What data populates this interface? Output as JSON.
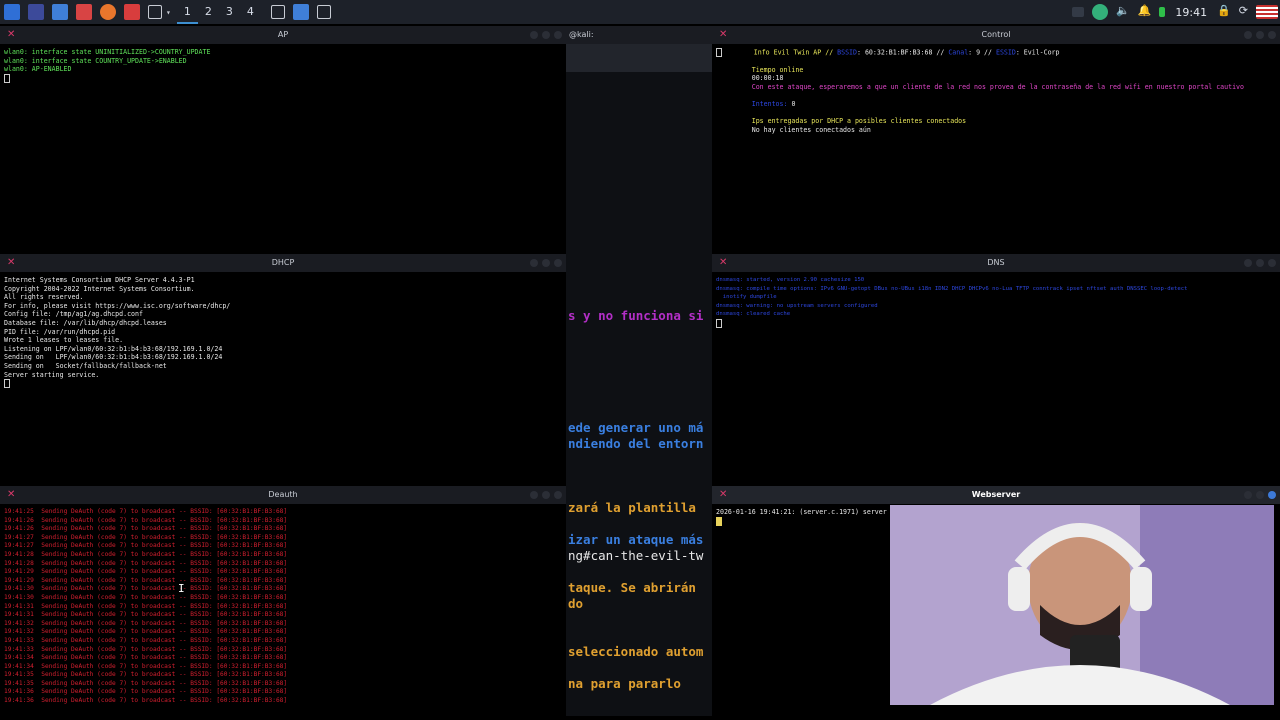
{
  "taskbar": {
    "workspaces": [
      "1",
      "2",
      "3",
      "4"
    ],
    "clock": "19:41",
    "icons": [
      "kali-menu-icon",
      "desktop-icon",
      "files-icon",
      "editor-icon",
      "firefox-icon",
      "burp-icon",
      "terminal-icon",
      "terminal-badge-icon",
      "files-blue-icon",
      "terminal-six-icon"
    ],
    "tray_icons": [
      "screen-icon",
      "refresh-icon",
      "volume-icon",
      "bell-icon",
      "battery-icon",
      "lock-icon",
      "reload-icon",
      "flag-us-icon"
    ]
  },
  "windows": {
    "ap": {
      "title": "AP",
      "lines": [
        "wlan0: interface state UNINITIALIZED->COUNTRY_UPDATE",
        "wlan0: interface state COUNTRY_UPDATE->ENABLED",
        "wlan0: AP-ENABLED"
      ]
    },
    "main": {
      "title": "@kali: ~/Desktop/arsenal/airgeddon",
      "fragments": [
        {
          "text": "s y no funciona si",
          "color": "#b32fc7"
        },
        {
          "text": "ede generar uno má",
          "color": "#3a7fe0"
        },
        {
          "text": "ndiendo del entorn",
          "color": "#3a7fe0"
        },
        {
          "text": "zará la plantilla",
          "color": "#e0a030"
        },
        {
          "text": "izar un ataque más",
          "color": "#3a7fe0"
        },
        {
          "text": "ng#can-the-evil-tw",
          "color": "#e8e8e8"
        },
        {
          "text": "taque. Se abrirán",
          "color": "#e0a030"
        },
        {
          "text": "do",
          "color": "#e0a030"
        },
        {
          "text": "seleccionado autom",
          "color": "#e0a030"
        },
        {
          "text": "na para pararlo",
          "color": "#e0a030"
        }
      ]
    },
    "control": {
      "title": "Control",
      "header_prefix": "Info Evil Twin AP // ",
      "bssid_label": "BSSID",
      "bssid_value": ": 60:32:B1:BF:B3:68 // ",
      "channel_label": "Canal",
      "channel_value": ": 9 // ",
      "essid_label": "ESSID",
      "essid_value": ": Evil-Corp",
      "time_label": "Tiempo online",
      "time_value": "00:00:18",
      "attack_desc": "Con este ataque, esperaremos a que un cliente de la red nos provea de la contraseña de la red wifi en nuestro portal cautivo",
      "attempts_label": "Intentos:",
      "attempts_value": " 0",
      "dhcp_header": "Ips entregadas por DHCP a posibles clientes conectados",
      "no_clients": "No hay clientes conectados aún"
    },
    "dhcp": {
      "title": "DHCP",
      "lines": [
        "Internet Systems Consortium DHCP Server 4.4.3-P1",
        "Copyright 2004-2022 Internet Systems Consortium.",
        "All rights reserved.",
        "For info, please visit https://www.isc.org/software/dhcp/",
        "Config file: /tmp/ag1/ag.dhcpd.conf",
        "Database file: /var/lib/dhcp/dhcpd.leases",
        "PID file: /var/run/dhcpd.pid",
        "Wrote 1 leases to leases file.",
        "Listening on LPF/wlan0/60:32:b1:b4:b3:68/192.169.1.0/24",
        "Sending on   LPF/wlan0/60:32:b1:b4:b3:68/192.169.1.0/24",
        "Sending on   Socket/fallback/fallback-net",
        "Server starting service."
      ]
    },
    "dns": {
      "title": "DNS",
      "lines": [
        "dnsmasq: started, version 2.90 cachesize 150",
        "dnsmasq: compile time options: IPv6 GNU-getopt DBus no-UBus i18n IDN2 DHCP DHCPv6 no-Lua TFTP conntrack ipset nftset auth DNSSEC loop-detect",
        "  inotify dumpfile",
        "dnsmasq: warning: no upstream servers configured",
        "dnsmasq: cleared cache"
      ]
    },
    "deauth": {
      "title": "Deauth",
      "lines": [
        "19:41:25  Sending DeAuth (code 7) to broadcast -- BSSID: [60:32:B1:BF:B3:68]",
        "19:41:26  Sending DeAuth (code 7) to broadcast -- BSSID: [60:32:B1:BF:B3:68]",
        "19:41:26  Sending DeAuth (code 7) to broadcast -- BSSID: [60:32:B1:BF:B3:68]",
        "19:41:27  Sending DeAuth (code 7) to broadcast -- BSSID: [60:32:B1:BF:B3:68]",
        "19:41:27  Sending DeAuth (code 7) to broadcast -- BSSID: [60:32:B1:BF:B3:68]",
        "19:41:28  Sending DeAuth (code 7) to broadcast -- BSSID: [60:32:B1:BF:B3:68]",
        "19:41:28  Sending DeAuth (code 7) to broadcast -- BSSID: [60:32:B1:BF:B3:68]",
        "19:41:29  Sending DeAuth (code 7) to broadcast -- BSSID: [60:32:B1:BF:B3:68]",
        "19:41:29  Sending DeAuth (code 7) to broadcast -- BSSID: [60:32:B1:BF:B3:68]",
        "19:41:30  Sending DeAuth (code 7) to broadcast -- BSSID: [60:32:B1:BF:B3:68]",
        "19:41:30  Sending DeAuth (code 7) to broadcast -- BSSID: [60:32:B1:BF:B3:68]",
        "19:41:31  Sending DeAuth (code 7) to broadcast -- BSSID: [60:32:B1:BF:B3:68]",
        "19:41:31  Sending DeAuth (code 7) to broadcast -- BSSID: [60:32:B1:BF:B3:68]",
        "19:41:32  Sending DeAuth (code 7) to broadcast -- BSSID: [60:32:B1:BF:B3:68]",
        "19:41:32  Sending DeAuth (code 7) to broadcast -- BSSID: [60:32:B1:BF:B3:68]",
        "19:41:33  Sending DeAuth (code 7) to broadcast -- BSSID: [60:32:B1:BF:B3:68]",
        "19:41:33  Sending DeAuth (code 7) to broadcast -- BSSID: [60:32:B1:BF:B3:68]",
        "19:41:34  Sending DeAuth (code 7) to broadcast -- BSSID: [60:32:B1:BF:B3:68]",
        "19:41:34  Sending DeAuth (code 7) to broadcast -- BSSID: [60:32:B1:BF:B3:68]",
        "19:41:35  Sending DeAuth (code 7) to broadcast -- BSSID: [60:32:B1:BF:B3:68]",
        "19:41:35  Sending DeAuth (code 7) to broadcast -- BSSID: [60:32:B1:BF:B3:68]",
        "19:41:36  Sending DeAuth (code 7) to broadcast -- BSSID: [60:32:B1:BF:B3:68]",
        "19:41:36  Sending DeAuth (code 7) to broadcast -- BSSID: [60:32:B1:BF:B3:68]"
      ]
    },
    "webserver": {
      "title": "Webserver",
      "log": "2026-01-16 19:41:21: (server.c.1971) server"
    }
  },
  "colors": {
    "accent": "#3d8fd1",
    "close": "#d93a6a",
    "green": "#5fe35a",
    "red": "#d21f2f",
    "yellow": "#e8e65a",
    "magenta": "#e046c8",
    "blue": "#2d47e0"
  }
}
